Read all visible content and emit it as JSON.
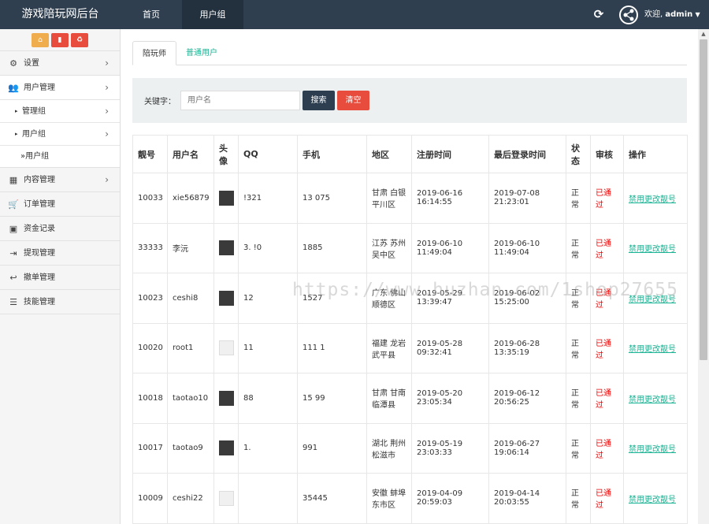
{
  "header": {
    "title": "游戏陪玩网后台",
    "nav": [
      "首页",
      "用户组"
    ],
    "welcome": "欢迎,",
    "user": "admin"
  },
  "icons": {
    "refresh": "refresh-icon",
    "user_menu": "share-circle-icon"
  },
  "sidebar": {
    "items": [
      {
        "label": "设置",
        "icon": "gear-icon"
      },
      {
        "label": "用户管理",
        "icon": "users-icon"
      },
      {
        "label": "管理组"
      },
      {
        "label": "用户组"
      },
      {
        "label": "»用户组"
      },
      {
        "label": "内容管理",
        "icon": "grid-icon"
      },
      {
        "label": "订单管理",
        "icon": "cart-icon"
      },
      {
        "label": "资金记录",
        "icon": "money-icon"
      },
      {
        "label": "提现管理",
        "icon": "sign-in-icon"
      },
      {
        "label": "撤单管理",
        "icon": "reply-icon"
      },
      {
        "label": "技能管理",
        "icon": "list-icon"
      }
    ]
  },
  "tabs": [
    "陪玩师",
    "普通用户"
  ],
  "search": {
    "label": "关键字：",
    "placeholder": "用户名",
    "search_button": "搜索",
    "clear_button": "清空"
  },
  "table": {
    "headers": [
      "靓号",
      "用户名",
      "头像",
      "QQ",
      "手机",
      "地区",
      "注册时间",
      "最后登录时间",
      "状态",
      "审核",
      "操作"
    ],
    "rows": [
      {
        "id": "10033",
        "username": "xie56879",
        "qq": "!321",
        "phone": "13  075",
        "region": "甘肃 白银 平川区",
        "reg": "2019-06-16 16:14:55",
        "last": "2019-07-08 21:23:01",
        "status": "正常",
        "audit": "已通过",
        "avatar": "photo"
      },
      {
        "id": "33333",
        "username": "李沅",
        "qq": "3.  !0",
        "phone": "1885",
        "region": "江苏 苏州 吴中区",
        "reg": "2019-06-10 11:49:04",
        "last": "2019-06-10 11:49:04",
        "status": "正常",
        "audit": "已通过",
        "avatar": "photo"
      },
      {
        "id": "10023",
        "username": "ceshi8",
        "qq": "12",
        "phone": "1527",
        "region": "广东 佛山 顺德区",
        "reg": "2019-05-29 13:39:47",
        "last": "2019-06-02 15:25:00",
        "status": "正常",
        "audit": "已通过",
        "avatar": "photo"
      },
      {
        "id": "10020",
        "username": "root1",
        "qq": "11",
        "phone": "111  1",
        "region": "福建 龙岩 武平县",
        "reg": "2019-05-28 09:32:41",
        "last": "2019-06-28 13:35:19",
        "status": "正常",
        "audit": "已通过",
        "avatar": "empty"
      },
      {
        "id": "10018",
        "username": "taotao10",
        "qq": "88",
        "phone": "15  99",
        "region": "甘肃 甘南 临潭县",
        "reg": "2019-05-20 23:05:34",
        "last": "2019-06-12 20:56:25",
        "status": "正常",
        "audit": "已通过",
        "avatar": "photo"
      },
      {
        "id": "10017",
        "username": "taotao9",
        "qq": "1.",
        "phone": "991",
        "region": "湖北 荆州 松滋市",
        "reg": "2019-05-19 23:03:33",
        "last": "2019-06-27 19:06:14",
        "status": "正常",
        "audit": "已通过",
        "avatar": "photo"
      },
      {
        "id": "10009",
        "username": "ceshi22",
        "qq": "",
        "phone": "35445",
        "region": "安徽 蚌埠 东市区",
        "reg": "2019-04-09 20:59:03",
        "last": "2019-04-14 20:03:55",
        "status": "正常",
        "audit": "已通过",
        "avatar": "empty"
      }
    ],
    "actions": [
      "禁用",
      "更改靓号"
    ]
  },
  "watermark": "https://www.huzhan.com/1shop27655"
}
